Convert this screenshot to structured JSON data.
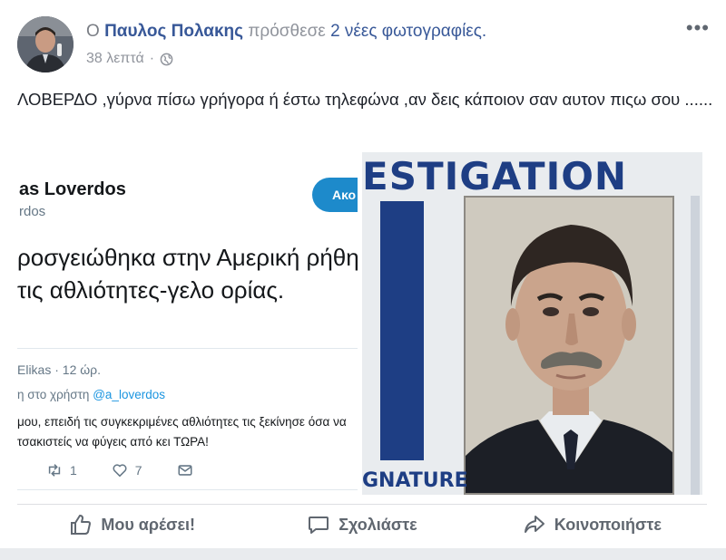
{
  "post": {
    "header_prefix": "Ο",
    "author": "Παυλος Πολακης",
    "verb": "πρόσθεσε",
    "photos_link": "2 νέες φωτογραφίες.",
    "time": "38 λεπτά",
    "privacy_icon": "globe-icon",
    "more_icon": "more-options-icon",
    "more_text": "•••",
    "text": "ΛΟΒΕΡΔΟ ,γύρνα πίσω γρήγορα ή έστω τηλεφώνα ,αν δεις κάποιον σαν αυτον πιςω σου ......"
  },
  "tweet_photo": {
    "name": "as Loverdos",
    "handle": "rdos",
    "follow_label": "Ακο",
    "body": "ροσγειώθηκα στην Αμερική ρήθηκα τις αθλιότητες-γελο ορίας.",
    "reply_head": "Elikas · 12 ώρ.",
    "reply_to_prefix": "η στο χρήστη",
    "reply_to_mention": "@a_loverdos",
    "reply_text": "μου, επειδή τις συγκεκριμένες αθλιότητες τις ξεκίνησε όσα να τσακιστείς να φύγεις από κει ΤΩΡΑ!",
    "retweets": "1",
    "likes": "7"
  },
  "id_photo": {
    "title": "ESTIGATION",
    "signature": "GNATURE"
  },
  "actions": {
    "like": "Μου αρέσει!",
    "comment": "Σχολιάστε",
    "share": "Κοινοποιήστε"
  },
  "colors": {
    "link": "#385898",
    "muted": "#90949c",
    "id_blue": "#1e3e84",
    "twitter_blue": "#1d8acb"
  }
}
